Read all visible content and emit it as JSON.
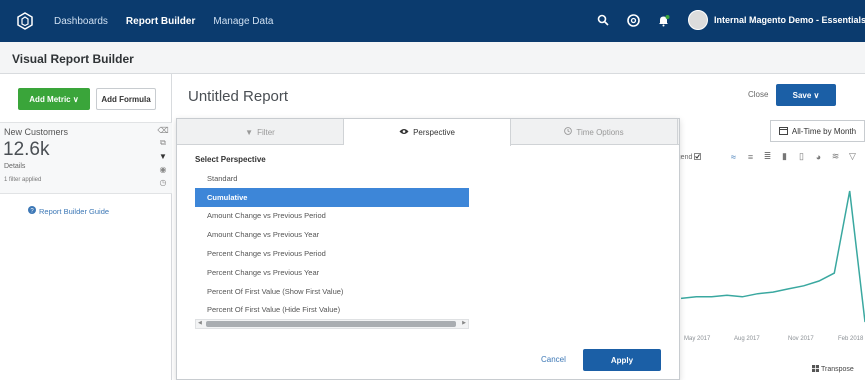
{
  "topbar": {
    "nav": [
      "Dashboards",
      "Report Builder",
      "Manage Data"
    ],
    "user_label": "Internal Magento Demo - Essentials ∨"
  },
  "subheader": {
    "title": "Visual Report Builder"
  },
  "leftpanel": {
    "add_metric_label": "Add Metric ∨",
    "add_formula_label": "Add Formula",
    "metric": {
      "name": "New Customers",
      "value": "12.6k",
      "details": "Details",
      "filters": "1 filter applied"
    },
    "guide_link": "Report Builder Guide"
  },
  "main": {
    "report_title": "Untitled Report",
    "close_label": "Close",
    "save_label": "Save ∨",
    "time_label": "All-Time by Month",
    "legend_label": "Legend",
    "transpose_label": "Transpose"
  },
  "modal": {
    "tabs": [
      {
        "label": "Filter",
        "icon": "filter-icon"
      },
      {
        "label": "Perspective",
        "icon": "eye-icon"
      },
      {
        "label": "Time Options",
        "icon": "clock-icon"
      }
    ],
    "section_label": "Select Perspective",
    "perspectives": [
      "Standard",
      "Cumulative",
      "Amount Change vs Previous Period",
      "Amount Change vs Previous Year",
      "Percent Change vs Previous Period",
      "Percent Change vs Previous Year",
      "Percent Of First Value (Show First Value)",
      "Percent Of First Value (Hide First Value)"
    ],
    "selected_index": 1,
    "cancel_label": "Cancel",
    "apply_label": "Apply"
  },
  "chart_data": {
    "type": "line",
    "x_ticks": [
      "May 2017",
      "Aug 2017",
      "Nov 2017",
      "Feb 2018"
    ],
    "series": [
      {
        "values": [
          0.2,
          0.21,
          0.21,
          0.22,
          0.21,
          0.23,
          0.24,
          0.26,
          0.28,
          0.31,
          0.36,
          0.88,
          0.05
        ]
      }
    ],
    "ylim": [
      0,
      1
    ],
    "color": "#3aa8a0"
  }
}
